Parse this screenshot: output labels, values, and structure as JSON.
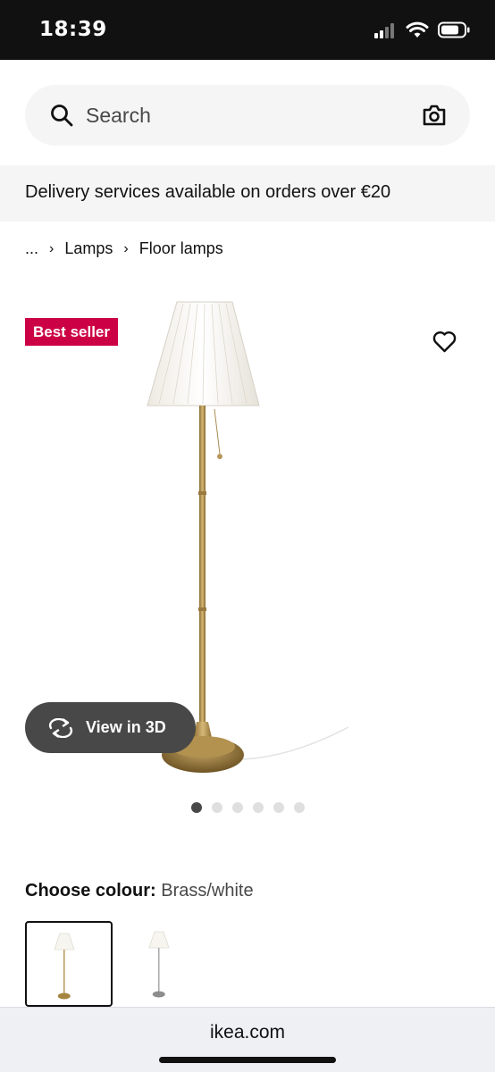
{
  "status_bar": {
    "time": "18:39",
    "icons": [
      "signal-icon",
      "wifi-icon",
      "battery-icon"
    ]
  },
  "search": {
    "placeholder": "Search",
    "icons": [
      "search-icon",
      "camera-icon"
    ]
  },
  "banner": {
    "text": "Delivery services available on orders over €20"
  },
  "breadcrumb": {
    "items": [
      "...",
      "Lamps",
      "Floor lamps"
    ]
  },
  "product": {
    "badge": "Best seller",
    "view_3d_label": "View in 3D",
    "carousel": {
      "total": 6,
      "active_index": 0
    },
    "favourite_icon": "heart-icon"
  },
  "colour": {
    "label": "Choose colour:",
    "selected_value": "Brass/white",
    "swatches": [
      "Brass/white",
      "Nickel/white"
    ]
  },
  "browser": {
    "url": "ikea.com"
  },
  "colors": {
    "badge": "#cc0044",
    "brass": "#b8985a",
    "dark_button": "#484848"
  }
}
